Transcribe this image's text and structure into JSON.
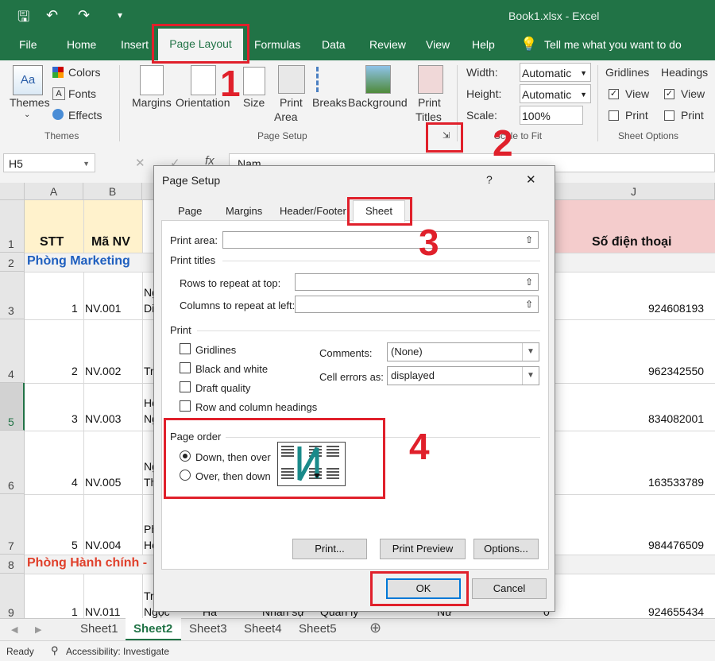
{
  "window": {
    "title": "Book1.xlsx  -  Excel"
  },
  "tabs": [
    "File",
    "Home",
    "Insert",
    "Page Layout",
    "Formulas",
    "Data",
    "Review",
    "View",
    "Help"
  ],
  "tell_me": "Tell me what you want to do",
  "ribbon": {
    "themes": {
      "themes_label": "Themes",
      "colors": "Colors",
      "fonts": "Fonts",
      "effects": "Effects",
      "group": "Themes"
    },
    "page_setup": {
      "margins": "Margins",
      "orientation": "Orientation",
      "size": "Size",
      "print_area_1": "Print",
      "print_area_2": "Area",
      "breaks": "Breaks",
      "background": "Background",
      "print_titles_1": "Print",
      "print_titles_2": "Titles",
      "group": "Page Setup"
    },
    "scale_to_fit": {
      "width_label": "Width:",
      "width_value": "Automatic",
      "height_label": "Height:",
      "height_value": "Automatic",
      "scale_label": "Scale:",
      "scale_value": "100%",
      "group": "Scale to Fit"
    },
    "sheet_options": {
      "gridlines": "Gridlines",
      "headings": "Headings",
      "view": "View",
      "print": "Print",
      "group": "Sheet Options"
    }
  },
  "formula_bar": {
    "name_box": "H5",
    "formula": "Nam"
  },
  "grid": {
    "columns": [
      "A",
      "B",
      "J"
    ],
    "header_row": {
      "stt": "STT",
      "ma_nv": "Mã NV",
      "phone": "Số điện thoại"
    },
    "rows": [
      {
        "num": "1"
      },
      {
        "num": "2",
        "section": "Phòng Marketing"
      },
      {
        "num": "3",
        "stt": "1",
        "ma": "NV.001",
        "frag": "Ng",
        "frag2": "Di",
        "phone": "924608193"
      },
      {
        "num": "4",
        "stt": "2",
        "ma": "NV.002",
        "frag": "Tr",
        "phone": "962342550"
      },
      {
        "num": "5",
        "stt": "3",
        "ma": "NV.003",
        "frag": "Ho",
        "frag2": "Ng",
        "phone": "834082001"
      },
      {
        "num": "6",
        "stt": "4",
        "ma": "NV.005",
        "frag": "Ng",
        "frag2": "Th",
        "phone": "163533789"
      },
      {
        "num": "7",
        "stt": "5",
        "ma": "NV.004",
        "frag": "Ph",
        "frag2": "Ho",
        "phone": "984476509"
      },
      {
        "num": "8",
        "section": "Phòng Hành chính -"
      },
      {
        "num": "9",
        "stt": "1",
        "ma": "NV.011",
        "frag": "Tr",
        "frag2": "Ngọc",
        "c2": "Hà",
        "c3": "Nhân sự",
        "c4": "Quản lý",
        "c5": "Nữ",
        "c6": "0",
        "phone": "924655434"
      }
    ]
  },
  "sheets": [
    "Sheet1",
    "Sheet2",
    "Sheet3",
    "Sheet4",
    "Sheet5"
  ],
  "status": {
    "ready": "Ready",
    "accessibility": "Accessibility: Investigate"
  },
  "dialog": {
    "title": "Page Setup",
    "help": "?",
    "close": "✕",
    "tabs": [
      "Page",
      "Margins",
      "Header/Footer",
      "Sheet"
    ],
    "print_area": "Print area:",
    "print_titles": "Print titles",
    "rows_repeat": "Rows to repeat at top:",
    "cols_repeat": "Columns to repeat at left:",
    "print": "Print",
    "gridlines": "Gridlines",
    "black_white": "Black and white",
    "draft": "Draft quality",
    "row_col_headings": "Row and column headings",
    "comments_label": "Comments:",
    "comments_value": "(None)",
    "cell_errors_label": "Cell errors as:",
    "cell_errors_value": "displayed",
    "page_order": "Page order",
    "down_then_over": "Down, then over",
    "over_then_down": "Over, then down",
    "print_btn": "Print...",
    "print_preview": "Print Preview",
    "options": "Options...",
    "ok": "OK",
    "cancel": "Cancel"
  },
  "annotations": [
    "1",
    "2",
    "3",
    "4"
  ],
  "colors": {
    "excel_green": "#217346",
    "annotation_red": "#e0202b",
    "section_blue": "#1f5fbf",
    "section_red": "#e0402b",
    "header_yellow": "#fff2cc",
    "header_pink": "#f4cccc"
  }
}
